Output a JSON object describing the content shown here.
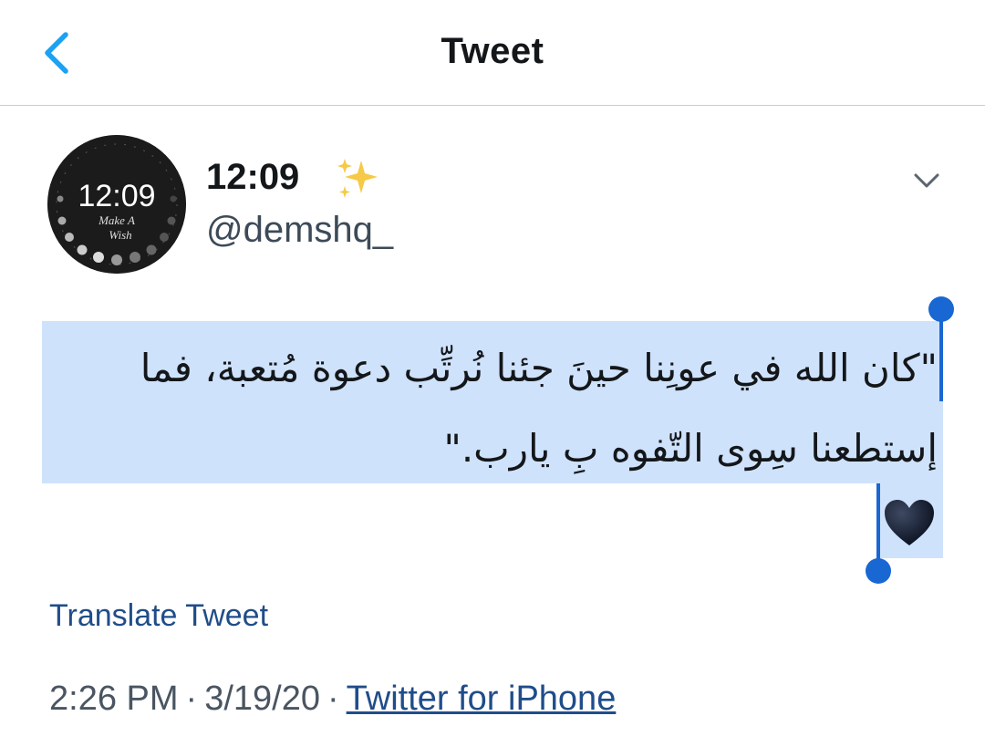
{
  "header": {
    "title": "Tweet",
    "back_icon": "chevron-left-icon"
  },
  "tweet": {
    "author": {
      "display_name": "12:09",
      "name_emoji": "sparkles-icon",
      "handle": "@demshq_",
      "avatar": {
        "time_text": "12:09",
        "script_line_1": "Make A",
        "script_line_2": "Wish"
      }
    },
    "menu_icon": "chevron-down-icon",
    "text": "\"كان الله في عونِنا حينَ جئنا نُرتِّب دعوة مُتعبة، فما إستطعنا سِوى التّفوه بِ يارب.\"",
    "text_emoji": "black-heart-icon",
    "translate_label": "Translate Tweet",
    "time": "2:26 PM",
    "date": "3/19/20",
    "separator": "·",
    "source": "Twitter for iPhone"
  },
  "colors": {
    "accent": "#1da1f2",
    "selection": "#cfe2fb",
    "selection_handle": "#1967d2",
    "link": "#1f4d8a"
  }
}
